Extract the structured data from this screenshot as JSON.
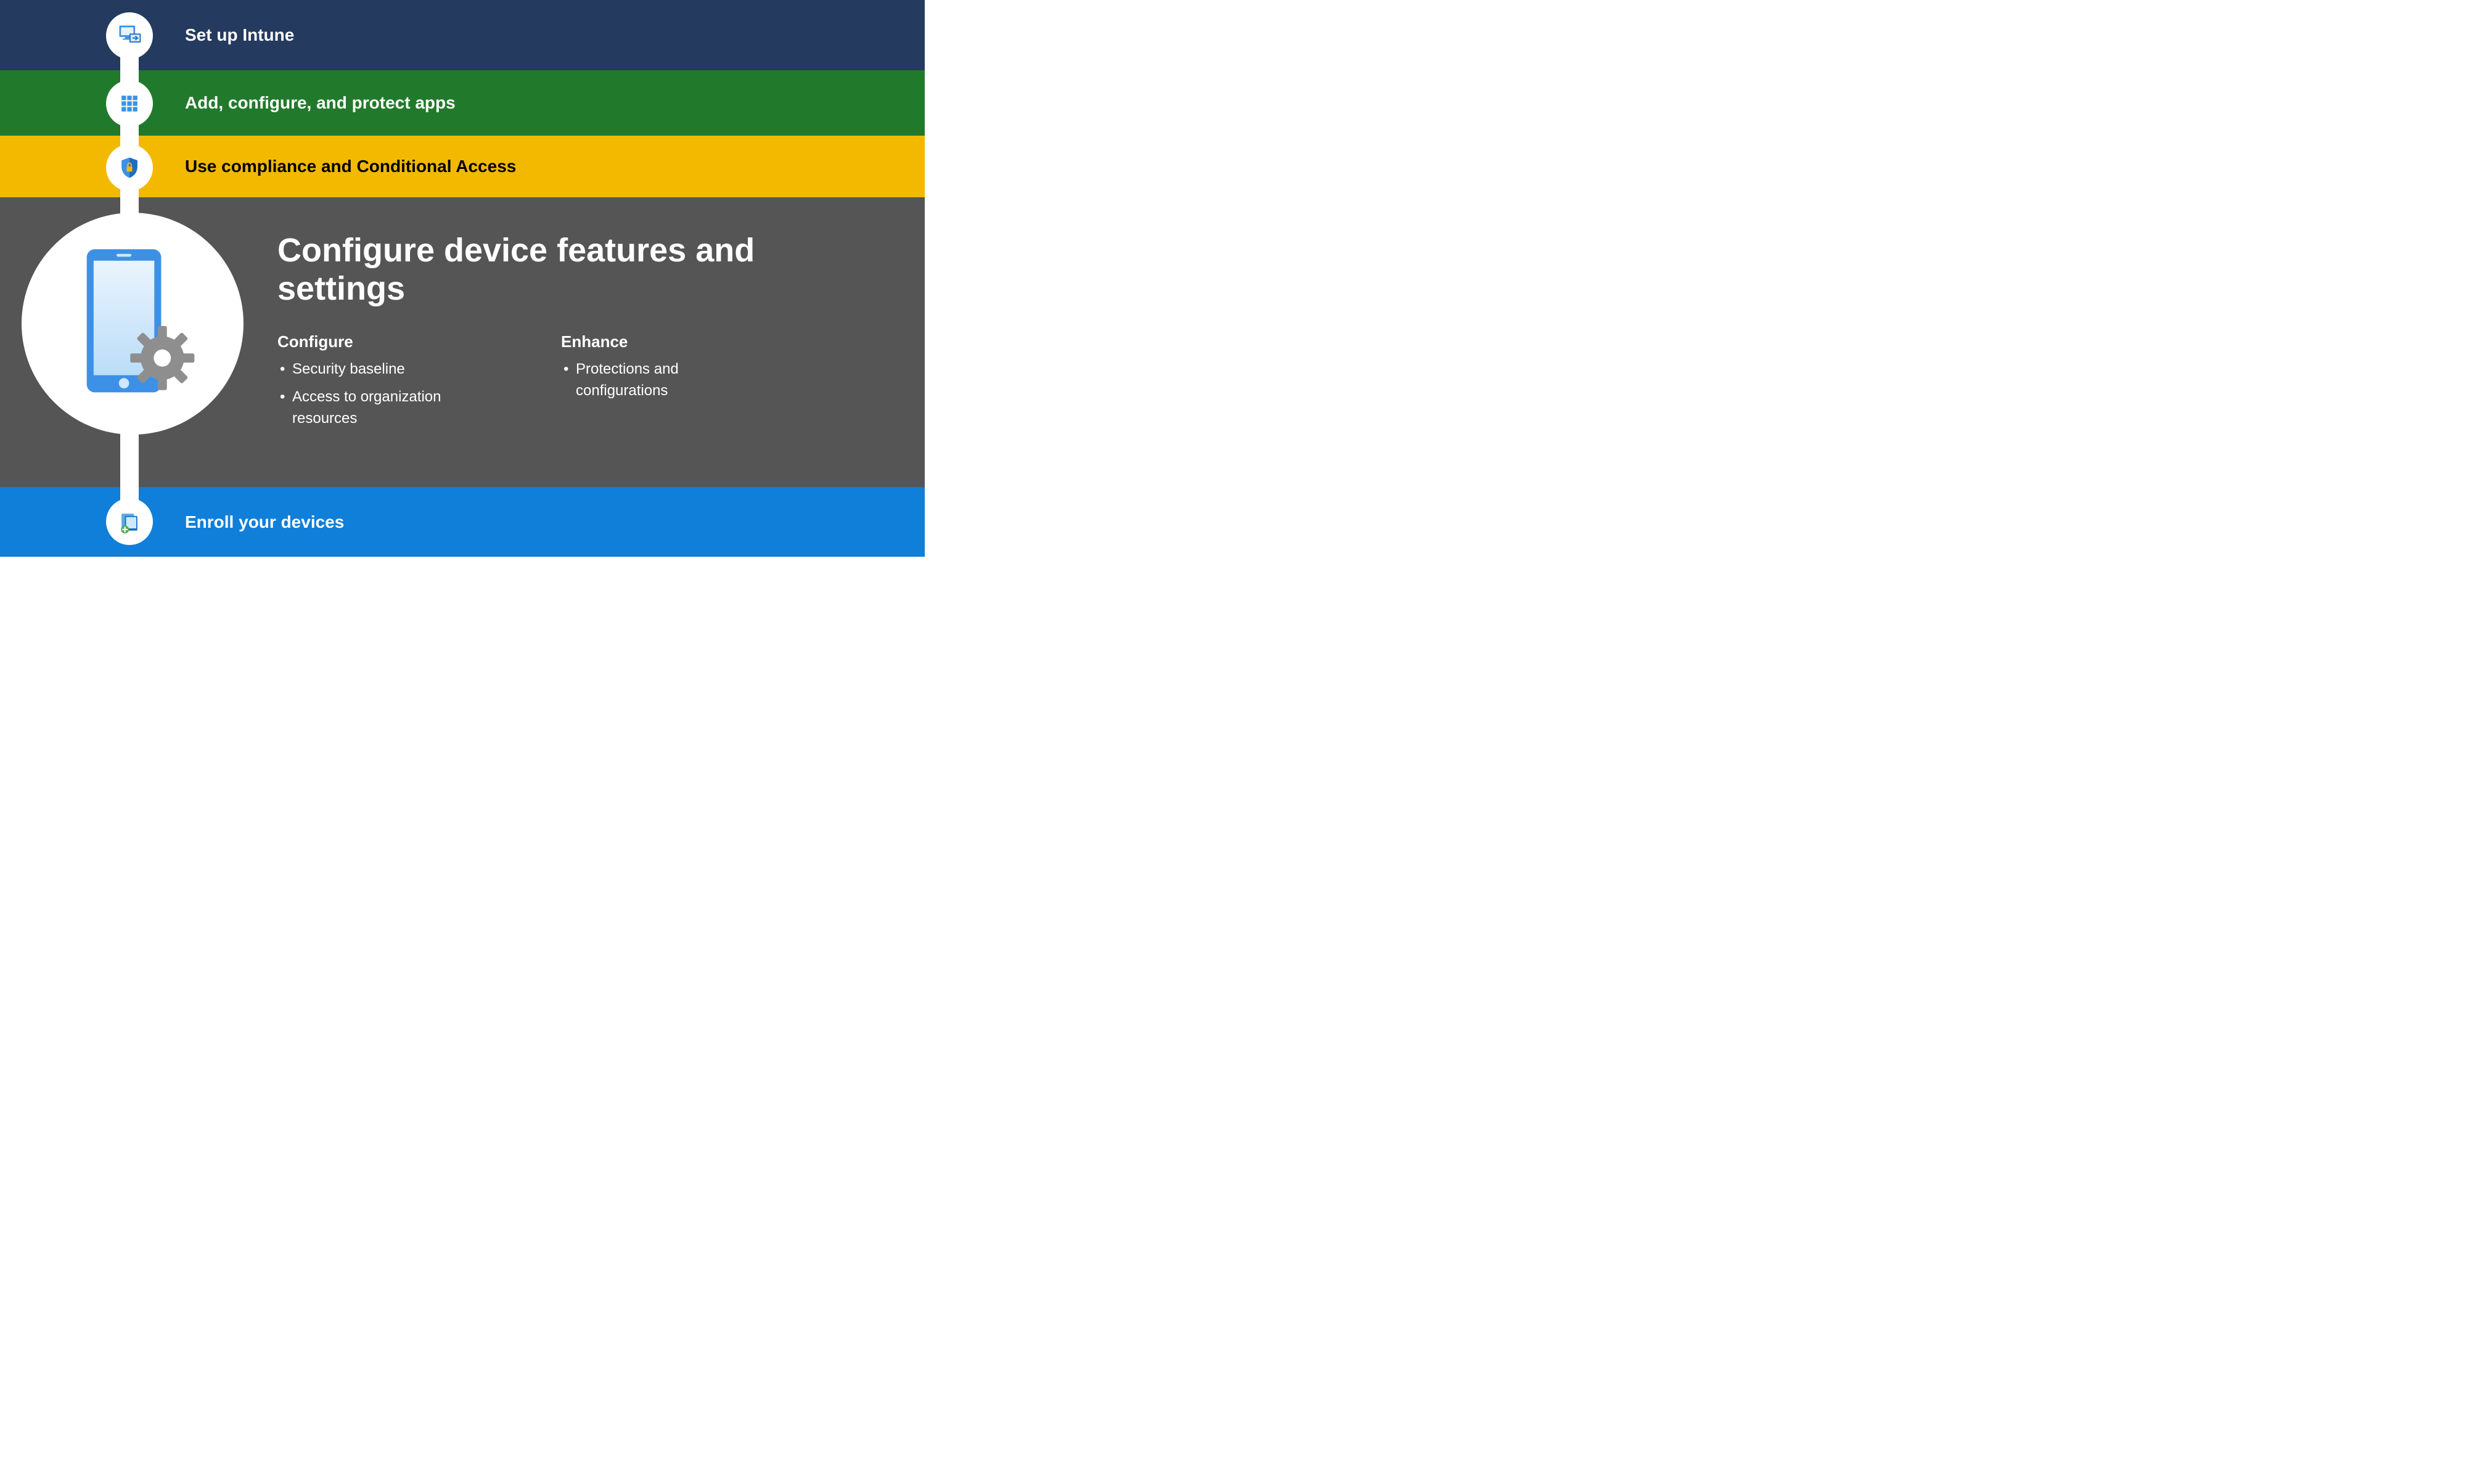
{
  "colors": {
    "band1": "#243A5E",
    "band2": "#217A2B",
    "band3": "#F2B900",
    "band4": "#555555",
    "band5": "#0F7FD9",
    "icon_blue": "#3C91E6",
    "icon_blue_dark": "#1B6FC2"
  },
  "steps": {
    "step1": {
      "label": "Set up Intune",
      "icon": "monitor-arrow-icon"
    },
    "step2": {
      "label": "Add, configure, and protect apps",
      "icon": "apps-grid-icon"
    },
    "step3": {
      "label": "Use compliance and Conditional Access",
      "icon": "shield-lock-icon"
    },
    "step4": {
      "title": "Configure device features and settings",
      "icon": "device-gear-icon",
      "columns": [
        {
          "heading": "Configure",
          "items": [
            "Security baseline",
            "Access to organization resources"
          ]
        },
        {
          "heading": "Enhance",
          "items": [
            "Protections and configurations"
          ]
        }
      ]
    },
    "step5": {
      "label": "Enroll your devices",
      "icon": "device-enroll-icon"
    }
  }
}
